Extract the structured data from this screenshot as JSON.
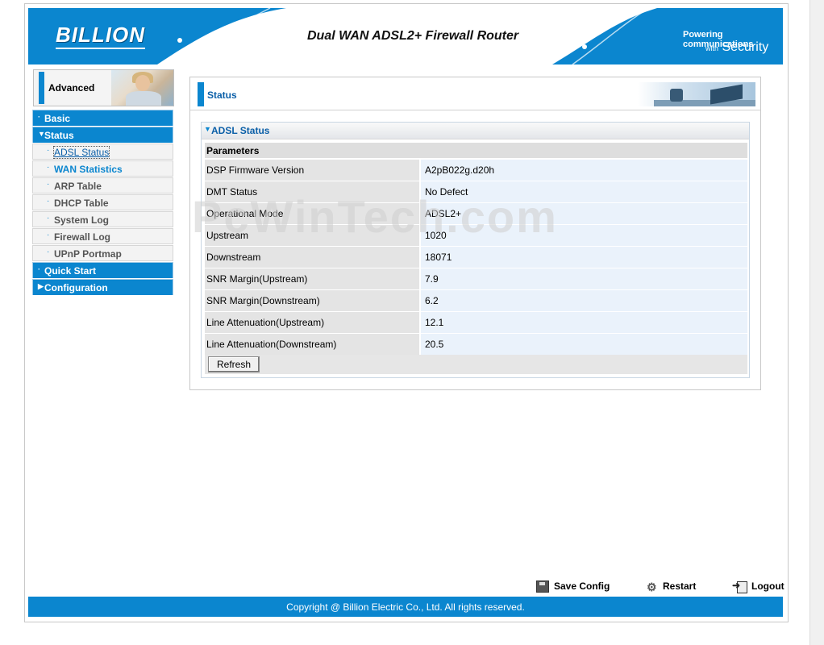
{
  "header": {
    "logo": "BILLION",
    "product_title": "Dual WAN ADSL2+ Firewall Router",
    "tagline_line1": "Powering communications",
    "tagline_line2_small": "with",
    "tagline_line2_big": "Security"
  },
  "sidebar": {
    "section_title": "Advanced",
    "items": [
      {
        "label": "Basic"
      },
      {
        "label": "Status"
      },
      {
        "label": "ADSL Status"
      },
      {
        "label": "WAN Statistics"
      },
      {
        "label": "ARP Table"
      },
      {
        "label": "DHCP Table"
      },
      {
        "label": "System Log"
      },
      {
        "label": "Firewall Log"
      },
      {
        "label": "UPnP Portmap"
      },
      {
        "label": "Quick Start"
      },
      {
        "label": "Configuration"
      }
    ]
  },
  "page": {
    "title": "Status",
    "panel_title": "ADSL Status",
    "params_header": "Parameters",
    "rows": [
      {
        "label": "DSP Firmware Version",
        "value": "A2pB022g.d20h"
      },
      {
        "label": "DMT Status",
        "value": "No Defect"
      },
      {
        "label": "Operational Mode",
        "value": "ADSL2+"
      },
      {
        "label": "Upstream",
        "value": "1020"
      },
      {
        "label": "Downstream",
        "value": "18071"
      },
      {
        "label": "SNR Margin(Upstream)",
        "value": "7.9"
      },
      {
        "label": "SNR Margin(Downstream)",
        "value": "6.2"
      },
      {
        "label": "Line Attenuation(Upstream)",
        "value": "12.1"
      },
      {
        "label": "Line Attenuation(Downstream)",
        "value": "20.5"
      }
    ],
    "refresh_label": "Refresh"
  },
  "watermark": "PcWinTech.com",
  "actions": {
    "save": "Save Config",
    "restart": "Restart",
    "logout": "Logout"
  },
  "footer": {
    "copyright": "Copyright @ Billion Electric Co., Ltd. All rights reserved."
  },
  "colors": {
    "brand_blue": "#0b86cf",
    "title_blue": "#0b5fa8",
    "value_bg": "#eaf2fb"
  }
}
